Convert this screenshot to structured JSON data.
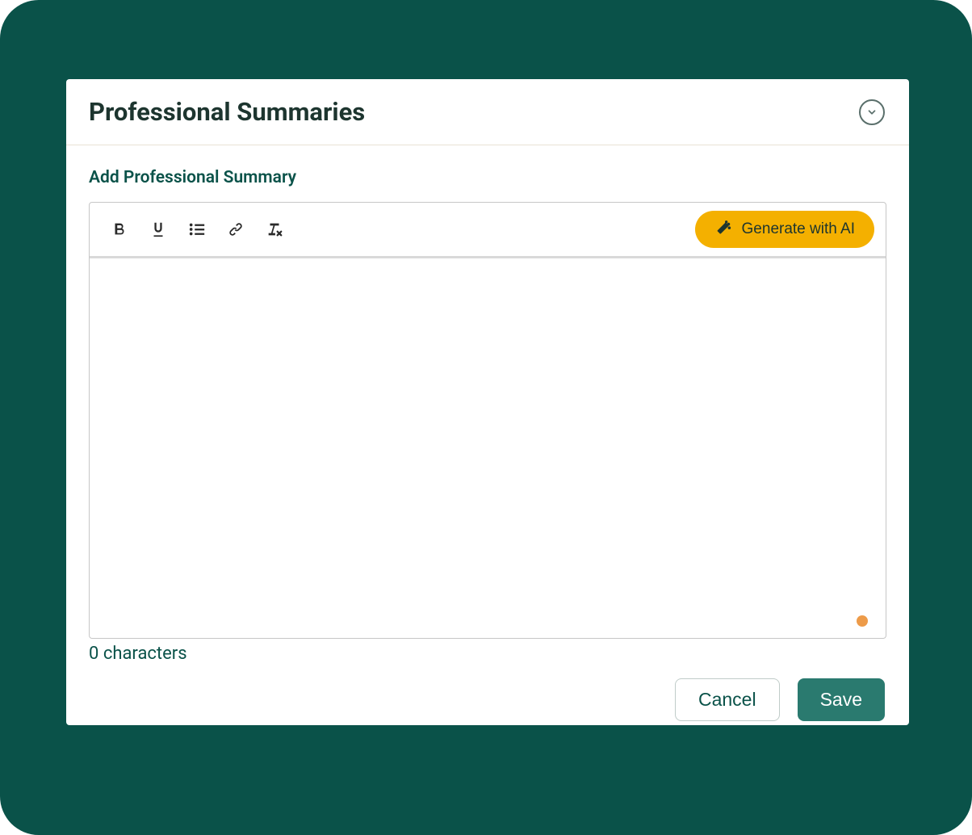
{
  "header": {
    "title": "Professional Summaries"
  },
  "subtitle": "Add Professional Summary",
  "toolbar": {
    "ai_button_label": "Generate with AI"
  },
  "editor": {
    "content": ""
  },
  "char_count": "0 characters",
  "actions": {
    "cancel_label": "Cancel",
    "save_label": "Save"
  },
  "colors": {
    "frame_bg": "#0a5249",
    "accent_yellow": "#f4b000",
    "primary_teal": "#2a7a6f"
  }
}
